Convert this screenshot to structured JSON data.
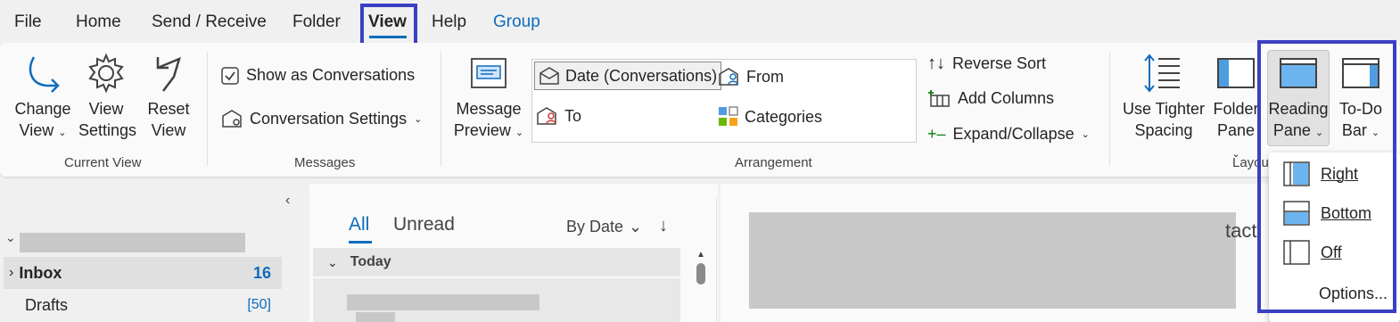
{
  "menu": {
    "file": "File",
    "home": "Home",
    "send_receive": "Send / Receive",
    "folder": "Folder",
    "view": "View",
    "help": "Help",
    "group": "Group"
  },
  "ribbon": {
    "current_view": {
      "label": "Current View",
      "change_view": [
        "Change",
        "View"
      ],
      "view_settings": [
        "View",
        "Settings"
      ],
      "reset_view": [
        "Reset",
        "View"
      ]
    },
    "messages": {
      "label": "Messages",
      "show_as_conversations": "Show as Conversations",
      "show_as_conversations_checked": true,
      "conversation_settings": "Conversation Settings"
    },
    "message_preview": [
      "Message",
      "Preview"
    ],
    "arrangement": {
      "label": "Arrangement",
      "items": [
        "Date (Conversations)",
        "From",
        "To",
        "Categories"
      ],
      "reverse_sort": "Reverse Sort",
      "add_columns": "Add Columns",
      "expand_collapse": "Expand/Collapse"
    },
    "layout": {
      "label": "Layout",
      "use_tighter_spacing": [
        "Use Tighter",
        "Spacing"
      ],
      "folder_pane": [
        "Folder",
        "Pane"
      ],
      "reading_pane": [
        "Reading",
        "Pane"
      ],
      "todo_bar": [
        "To-Do",
        "Bar"
      ]
    }
  },
  "reading_pane_menu": {
    "right": "Right",
    "bottom": "Bottom",
    "off": "Off",
    "options": "Options..."
  },
  "folders": {
    "inbox": "Inbox",
    "inbox_count": "16",
    "drafts": "Drafts",
    "drafts_count": "[50]"
  },
  "message_list": {
    "tab_all": "All",
    "tab_unread": "Unread",
    "sort": "By Date",
    "group_today": "Today"
  },
  "reading": {
    "partial_text": "tact"
  },
  "colors": {
    "accent": "#0f6cbd",
    "highlight": "#3b3fc4"
  }
}
